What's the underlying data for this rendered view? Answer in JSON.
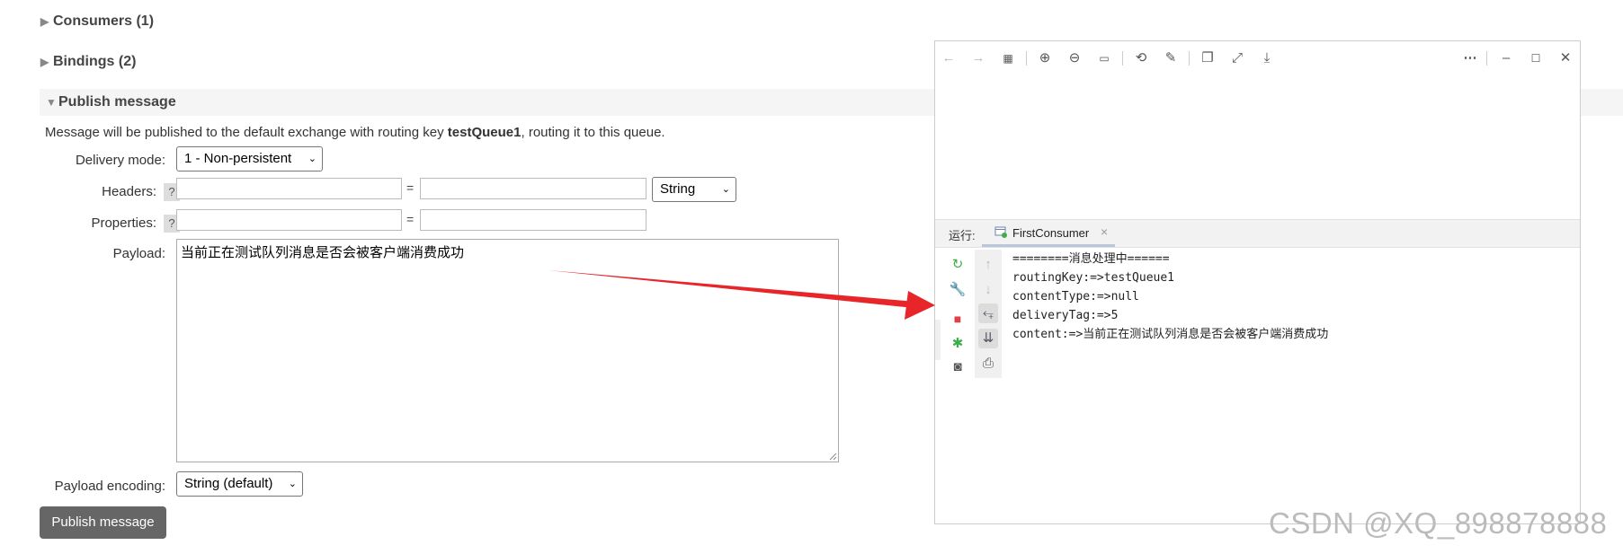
{
  "sections": {
    "consumers": "Consumers (1)",
    "bindings": "Bindings (2)",
    "publish": "Publish message"
  },
  "publish_form": {
    "info_prefix": "Message will be published to the default exchange with routing key ",
    "routing_key": "testQueue1",
    "info_suffix": ", routing it to this queue.",
    "delivery_mode_label": "Delivery mode:",
    "delivery_mode_value": "1 - Non-persistent",
    "headers_label": "Headers:",
    "headers_type": "String",
    "properties_label": "Properties:",
    "help": "?",
    "equals": "=",
    "payload_label": "Payload:",
    "payload_value": "当前正在测试队列消息是否会被客户端消费成功",
    "encoding_label": "Payload encoding:",
    "encoding_value": "String (default)",
    "button": "Publish message"
  },
  "ide": {
    "run_label": "运行:",
    "tab_label": "FirstConsumer",
    "console_lines": [
      "========消息处理中======",
      "routingKey:=>testQueue1",
      "contentType:=>null",
      "deliveryTag:=>5",
      "content:=>当前正在测试队列消息是否会被客户端消费成功"
    ]
  },
  "watermark": "CSDN @XQ_898878888",
  "colors": {
    "arrow": "#e8262a",
    "button": "#666666"
  }
}
